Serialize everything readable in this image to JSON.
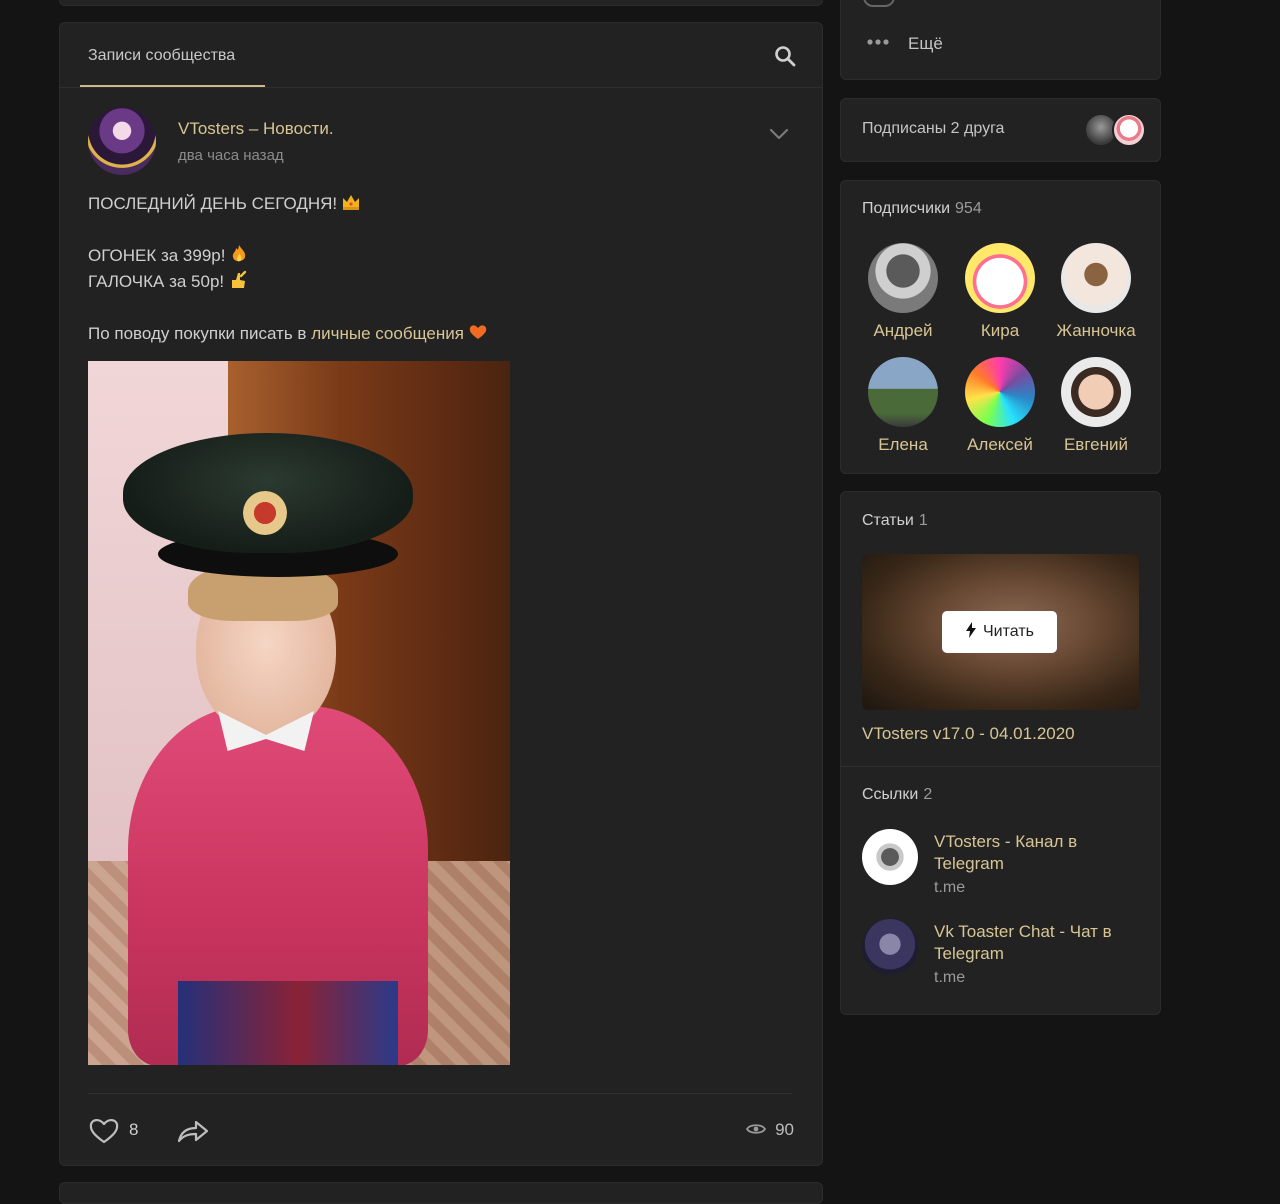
{
  "feed": {
    "tab_label": "Записи сообщества",
    "post": {
      "author": "VTosters – Новости.",
      "time": "два часа назад",
      "lines": [
        "ПОСЛЕДНИЙ ДЕНЬ СЕГОДНЯ!",
        "ОГОНЕК за 399р!",
        "ГАЛОЧКА за 50р!",
        "По поводу покупки писать в"
      ],
      "link_text": "личные сообщения",
      "likes": "8",
      "views": "90"
    }
  },
  "sidebar": {
    "more_label": "Ещё",
    "friends_label": "Подписаны 2 друга",
    "subscribers": {
      "title": "Подписчики",
      "count": "954",
      "people": [
        "Андрей",
        "Кира",
        "Жанночка",
        "Елена",
        "Алексей",
        "Евгений"
      ]
    },
    "articles": {
      "title": "Статьи",
      "count": "1",
      "read_button": "Читать",
      "article_title": "VTosters v17.0 - 04.01.2020"
    },
    "links": {
      "title": "Ссылки",
      "count": "2",
      "items": [
        {
          "title": "VTosters - Канал в Telegram",
          "domain": "t.me"
        },
        {
          "title": "Vk Toaster Chat - Чат в Telegram",
          "domain": "t.me"
        }
      ]
    }
  },
  "colors": {
    "accent_gold": "#d8c594",
    "background": "#141414",
    "card": "#222222"
  }
}
